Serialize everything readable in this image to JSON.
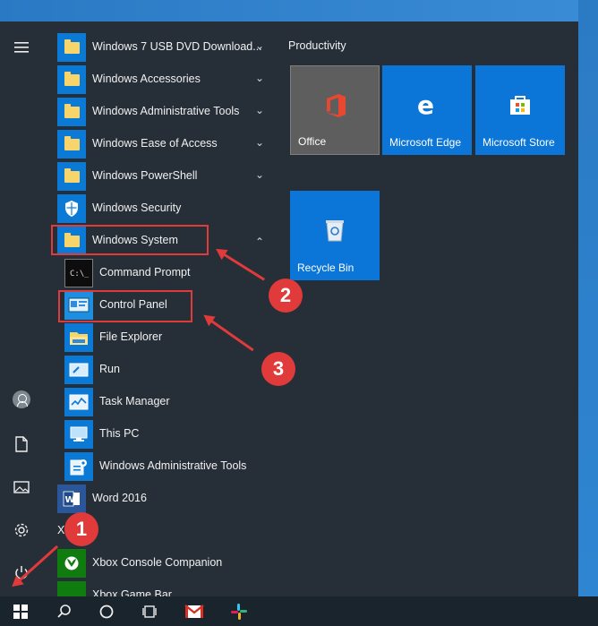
{
  "desktop": {
    "accent_color": "#1f6fb8",
    "highlight_color": "#e03a3a"
  },
  "left_bar": {
    "icons": [
      "hamburger-menu-icon",
      "user-avatar-icon",
      "documents-icon",
      "pictures-icon",
      "settings-gear-icon",
      "power-icon"
    ]
  },
  "app_list": {
    "folders": [
      {
        "label": "Windows 7 USB DVD Download...",
        "expanded": false
      },
      {
        "label": "Windows Accessories",
        "expanded": false
      },
      {
        "label": "Windows Administrative Tools",
        "expanded": false
      },
      {
        "label": "Windows Ease of Access",
        "expanded": false
      },
      {
        "label": "Windows PowerShell",
        "expanded": false
      }
    ],
    "security_label": "Windows Security",
    "system_label": "Windows System",
    "system_items": [
      "Command Prompt",
      "Control Panel",
      "File Explorer",
      "Run",
      "Task Manager",
      "This PC",
      "Windows Administrative Tools"
    ],
    "word_label": "Word 2016",
    "section_x": "X",
    "xbox_labels": [
      "Xbox Console Companion",
      "Xbox Game Bar"
    ]
  },
  "tiles": {
    "group_title": "Productivity",
    "items": [
      "Office",
      "Microsoft Edge",
      "Microsoft Store",
      "Recycle Bin"
    ]
  },
  "annotations": {
    "step1": "1",
    "step2": "2",
    "step3": "3"
  }
}
